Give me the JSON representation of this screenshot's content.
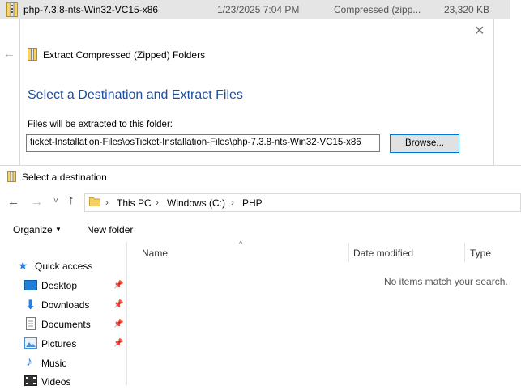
{
  "file_row": {
    "name": "php-7.3.8-nts-Win32-VC15-x86",
    "date": "1/23/2025 7:04 PM",
    "type": "Compressed (zipp...",
    "size": "23,320 KB"
  },
  "wizard": {
    "title": "Extract Compressed (Zipped) Folders",
    "heading": "Select a Destination and Extract Files",
    "extract_label": "Files will be extracted to this folder:",
    "path_value": "ticket-Installation-Files\\osTicket-Installation-Files\\php-7.3.8-nts-Win32-VC15-x86",
    "browse_label": "Browse..."
  },
  "dialog": {
    "title": "Select a destination",
    "breadcrumb": [
      "This PC",
      "Windows (C:)",
      "PHP"
    ],
    "toolbar": {
      "organize": "Organize",
      "new_folder": "New folder"
    },
    "nav_items": [
      {
        "label": "Quick access",
        "pinned": false
      },
      {
        "label": "Desktop",
        "pinned": true
      },
      {
        "label": "Downloads",
        "pinned": true
      },
      {
        "label": "Documents",
        "pinned": true
      },
      {
        "label": "Pictures",
        "pinned": true
      },
      {
        "label": "Music",
        "pinned": false
      },
      {
        "label": "Videos",
        "pinned": false
      }
    ],
    "columns": [
      "Name",
      "Date modified",
      "Type"
    ],
    "empty_message": "No items match your search."
  }
}
